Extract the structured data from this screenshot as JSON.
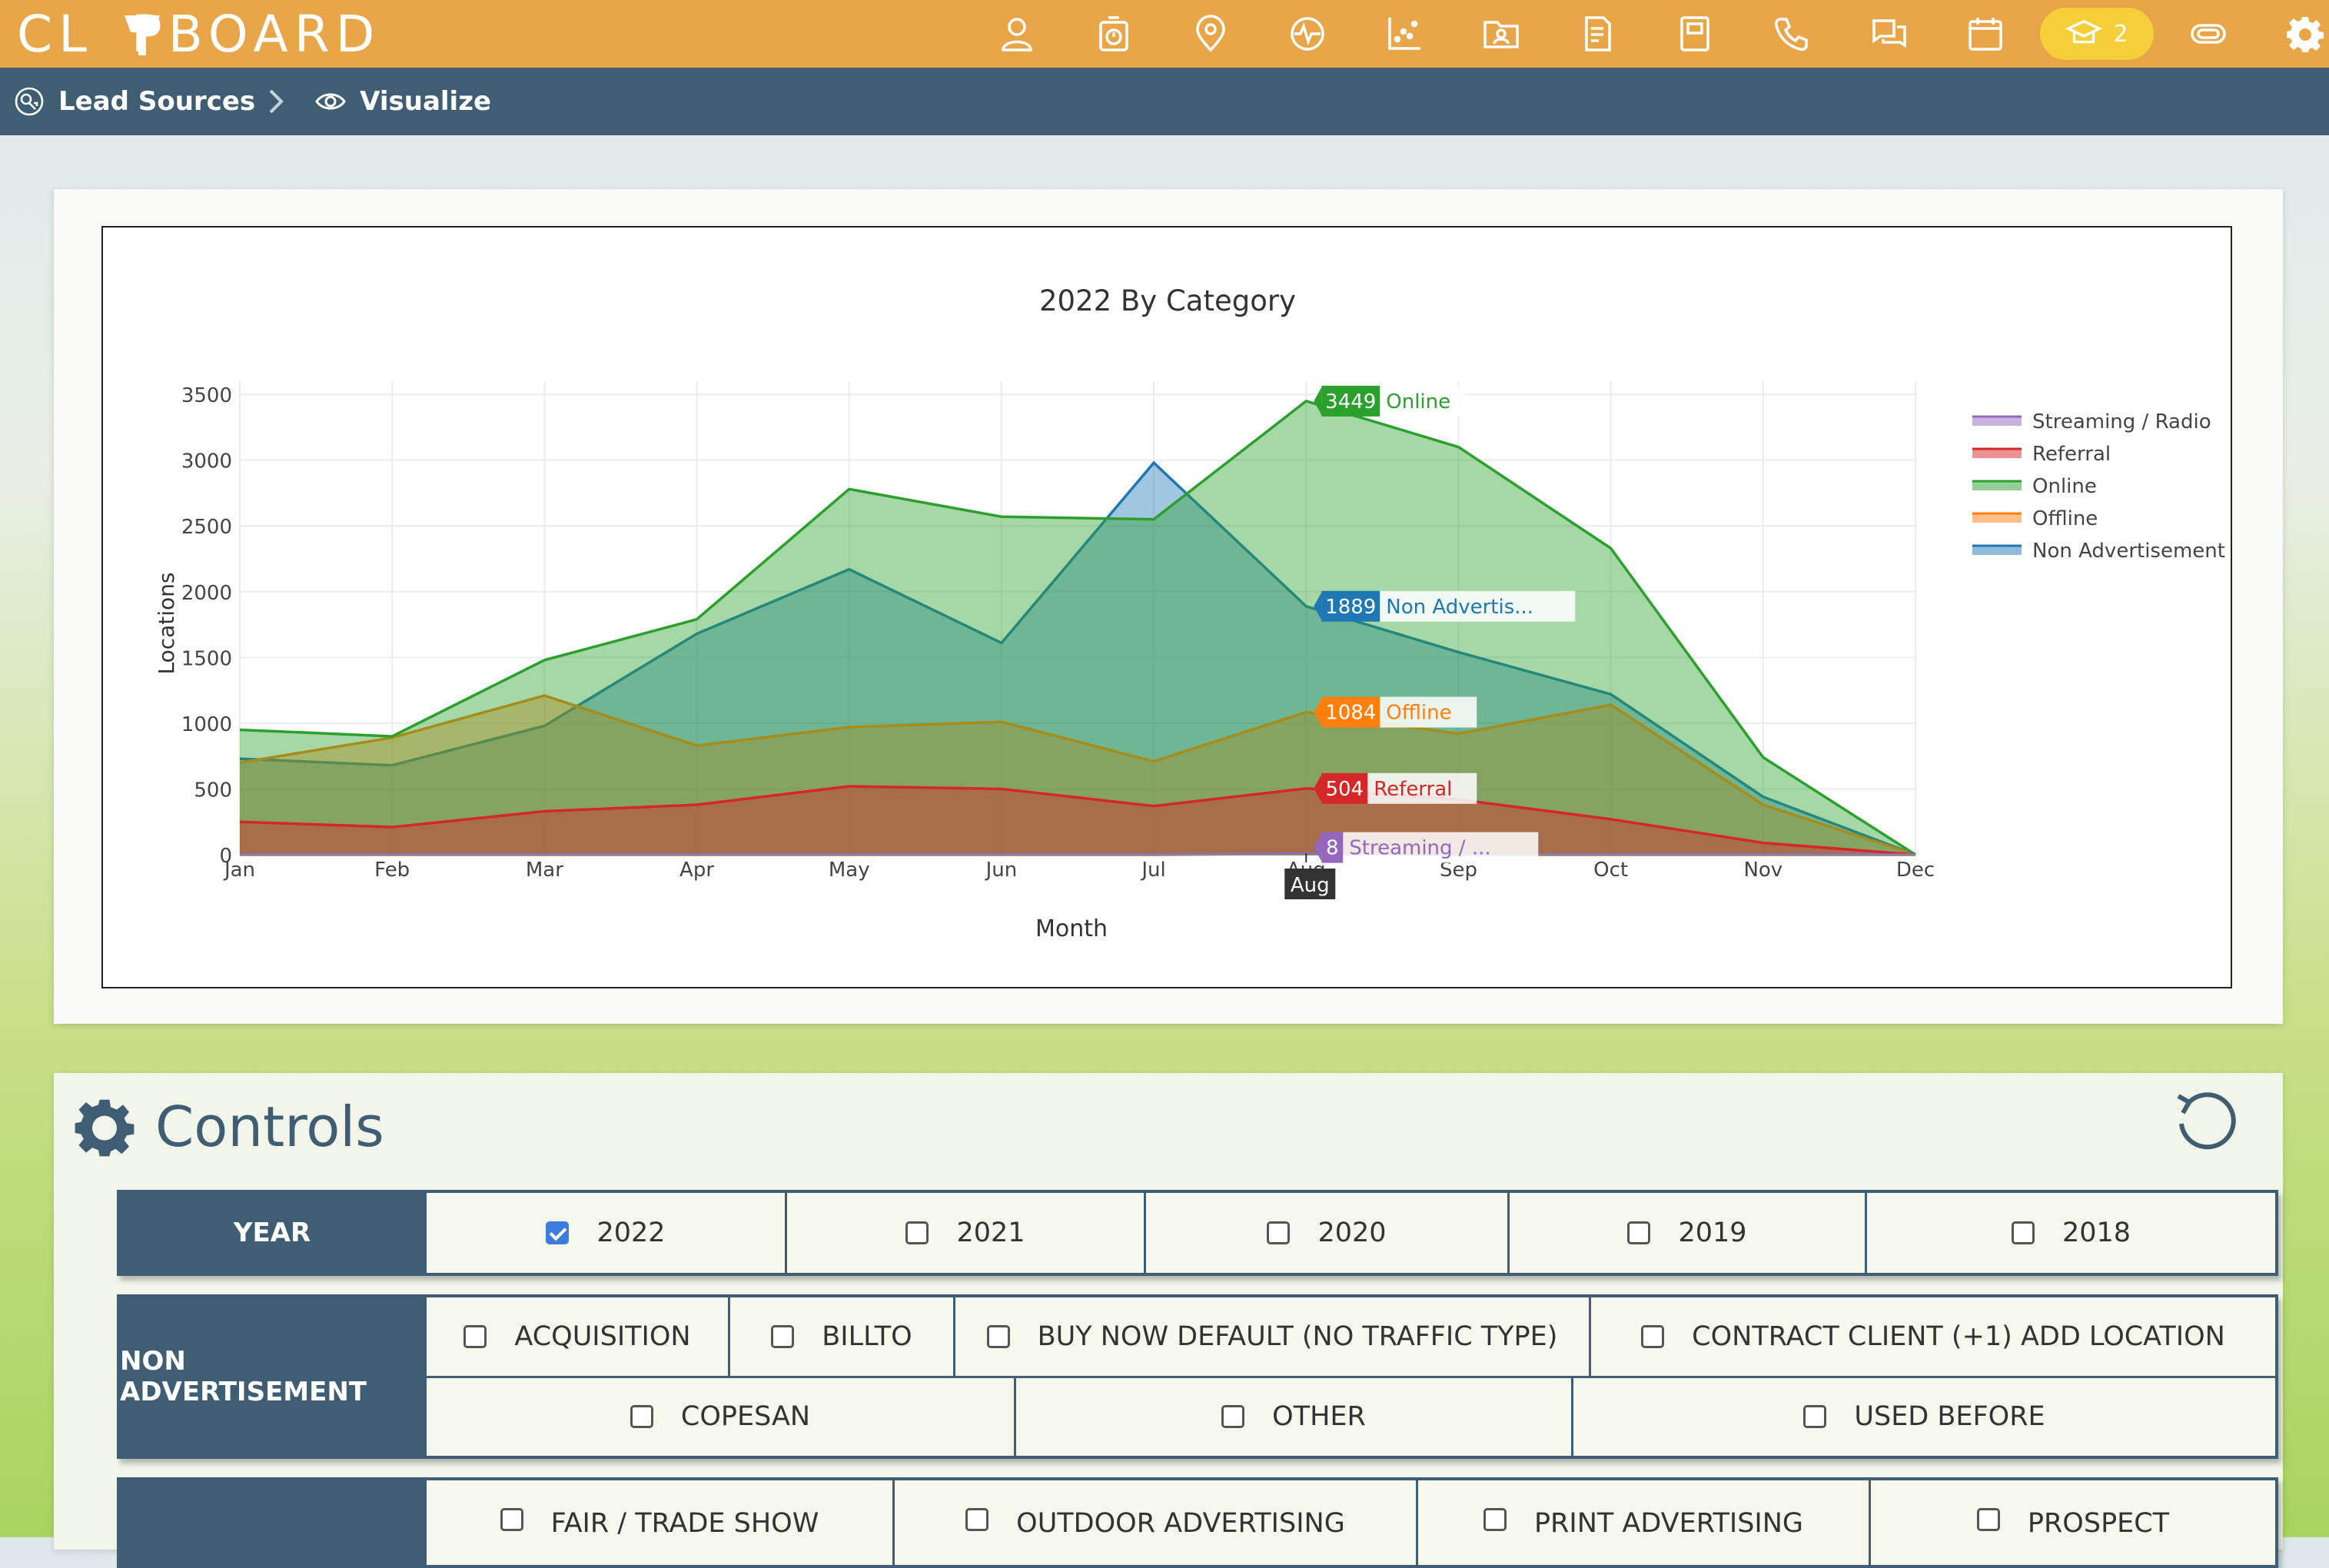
{
  "app": {
    "logo_text": "CL PBOARD",
    "notification_count": "2"
  },
  "nav": {
    "icons": [
      "user-icon",
      "timer-icon",
      "map-pin-icon",
      "activity-icon",
      "scatter-icon",
      "folder-user-icon",
      "document-icon",
      "book-icon",
      "phone-icon",
      "chat-icon",
      "calendar-icon",
      "training-icon",
      "link-icon",
      "gear-icon"
    ]
  },
  "breadcrumb": {
    "items": [
      "Lead Sources",
      "Visualize"
    ]
  },
  "chart_data": {
    "type": "area",
    "title": "2022 By Category",
    "xlabel": "Month",
    "ylabel": "Locations",
    "categories": [
      "Jan",
      "Feb",
      "Mar",
      "Apr",
      "May",
      "Jun",
      "Jul",
      "Aug",
      "Sep",
      "Oct",
      "Nov",
      "Dec"
    ],
    "ylim": [
      0,
      3600
    ],
    "yticks": [
      0,
      500,
      1000,
      1500,
      2000,
      2500,
      3000,
      3500
    ],
    "grid": true,
    "legend_position": "right",
    "hover_month": "Aug",
    "series": [
      {
        "name": "Streaming / Radio",
        "color": "#9467bd",
        "values": [
          0,
          0,
          0,
          0,
          0,
          0,
          0,
          8,
          0,
          0,
          0,
          0
        ],
        "hover_label": "8",
        "hover_name": "Streaming / ..."
      },
      {
        "name": "Referral",
        "color": "#d62728",
        "values": [
          250,
          210,
          330,
          380,
          520,
          500,
          370,
          504,
          420,
          270,
          90,
          0
        ],
        "hover_label": "504",
        "hover_name": "Referral"
      },
      {
        "name": "Online",
        "color": "#2ca02c",
        "values": [
          950,
          900,
          1480,
          1790,
          2780,
          2570,
          2550,
          3449,
          3100,
          2330,
          740,
          0
        ],
        "hover_label": "3449",
        "hover_name": "Online"
      },
      {
        "name": "Offline",
        "color": "#ff7f0e",
        "values": [
          700,
          890,
          1210,
          830,
          970,
          1010,
          710,
          1084,
          920,
          1140,
          380,
          0
        ],
        "hover_label": "1084",
        "hover_name": "Offline"
      },
      {
        "name": "Non Advertisement",
        "color": "#1f77b4",
        "values": [
          730,
          680,
          980,
          1680,
          2170,
          1610,
          2980,
          1889,
          1540,
          1220,
          440,
          0
        ],
        "hover_label": "1889",
        "hover_name": "Non Advertis..."
      }
    ]
  },
  "controls": {
    "title": "Controls",
    "year": {
      "label": "YEAR",
      "options": [
        {
          "label": "2022",
          "checked": true
        },
        {
          "label": "2021",
          "checked": false
        },
        {
          "label": "2020",
          "checked": false
        },
        {
          "label": "2019",
          "checked": false
        },
        {
          "label": "2018",
          "checked": false
        }
      ]
    },
    "non_advertisement": {
      "label": "NON ADVERTISEMENT",
      "row1": [
        "ACQUISITION",
        "BILLTO",
        "BUY NOW DEFAULT (NO TRAFFIC TYPE)",
        "CONTRACT CLIENT (+1) ADD LOCATION"
      ],
      "row2": [
        "COPESAN",
        "OTHER",
        "USED BEFORE"
      ]
    },
    "offline": {
      "row1": [
        "FAIR / TRADE SHOW",
        "OUTDOOR ADVERTISING",
        "PRINT ADVERTISING",
        "PROSPECT"
      ]
    }
  }
}
